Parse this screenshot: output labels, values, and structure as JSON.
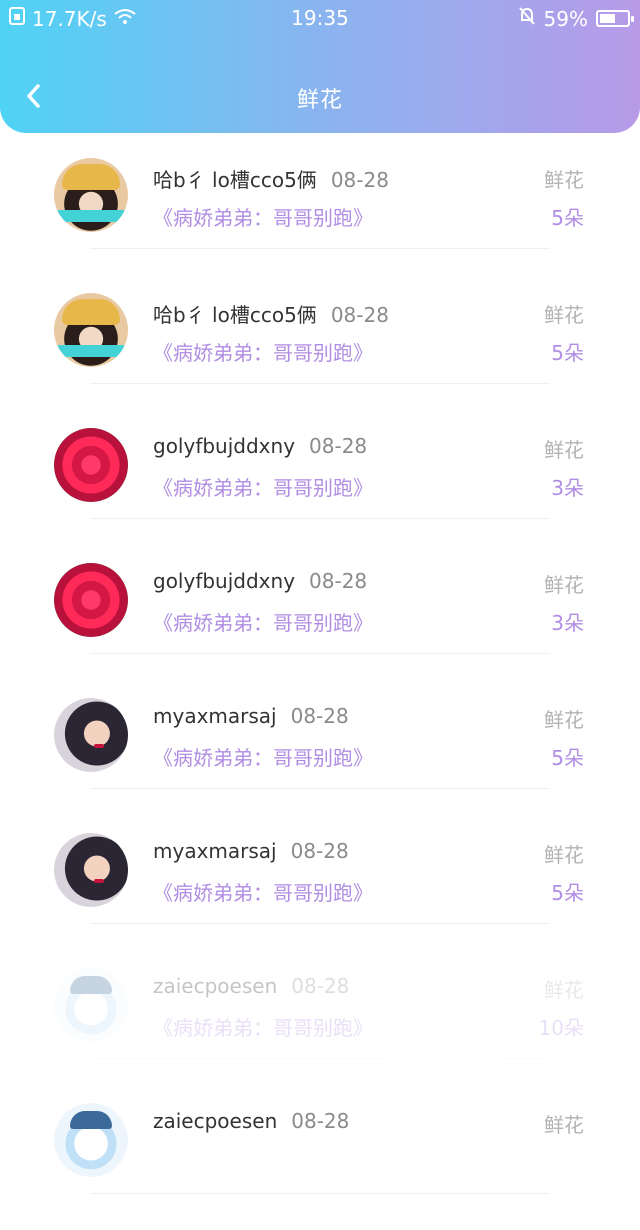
{
  "status_bar": {
    "sim_icon": "sim-card-icon",
    "network_speed": "17.7K/s",
    "wifi_icon": "wifi-icon",
    "time": "19:35",
    "alarm_icon": "bell-off-icon",
    "battery_percent": "59%",
    "battery_level": 0.59
  },
  "header": {
    "back_icon": "chevron-left-icon",
    "title": "鲜花",
    "gradient": [
      "#4fd3f5",
      "#b79ae8"
    ]
  },
  "list": [
    {
      "name": "哈b彳 lo槽cco5俩",
      "date": "08-28",
      "book": "《病娇弟弟：哥哥别跑》",
      "gift": "鲜花",
      "count": "5朵",
      "avatar": "girl-avatar"
    },
    {
      "name": "哈b彳 lo槽cco5俩",
      "date": "08-28",
      "book": "《病娇弟弟：哥哥别跑》",
      "gift": "鲜花",
      "count": "5朵",
      "avatar": "girl-avatar"
    },
    {
      "name": "golyfbujddxny",
      "date": "08-28",
      "book": "《病娇弟弟：哥哥别跑》",
      "gift": "鲜花",
      "count": "3朵",
      "avatar": "rose-avatar"
    },
    {
      "name": "golyfbujddxny",
      "date": "08-28",
      "book": "《病娇弟弟：哥哥别跑》",
      "gift": "鲜花",
      "count": "3朵",
      "avatar": "rose-avatar"
    },
    {
      "name": "myaxmarsaj",
      "date": "08-28",
      "book": "《病娇弟弟：哥哥别跑》",
      "gift": "鲜花",
      "count": "5朵",
      "avatar": "woman-avatar"
    },
    {
      "name": "myaxmarsaj",
      "date": "08-28",
      "book": "《病娇弟弟：哥哥别跑》",
      "gift": "鲜花",
      "count": "5朵",
      "avatar": "woman-avatar"
    },
    {
      "name": "zaiecpoesen",
      "date": "08-28",
      "book": "《病娇弟弟：哥哥别跑》",
      "gift": "鲜花",
      "count": "10朵",
      "avatar": "cartoon-avatar"
    },
    {
      "name": "zaiecpoesen",
      "date": "08-28",
      "book": "",
      "gift": "鲜花",
      "count": "",
      "avatar": "cartoon-avatar"
    }
  ],
  "colors": {
    "accent": "#b18ee3",
    "muted": "#b3b3b3"
  }
}
